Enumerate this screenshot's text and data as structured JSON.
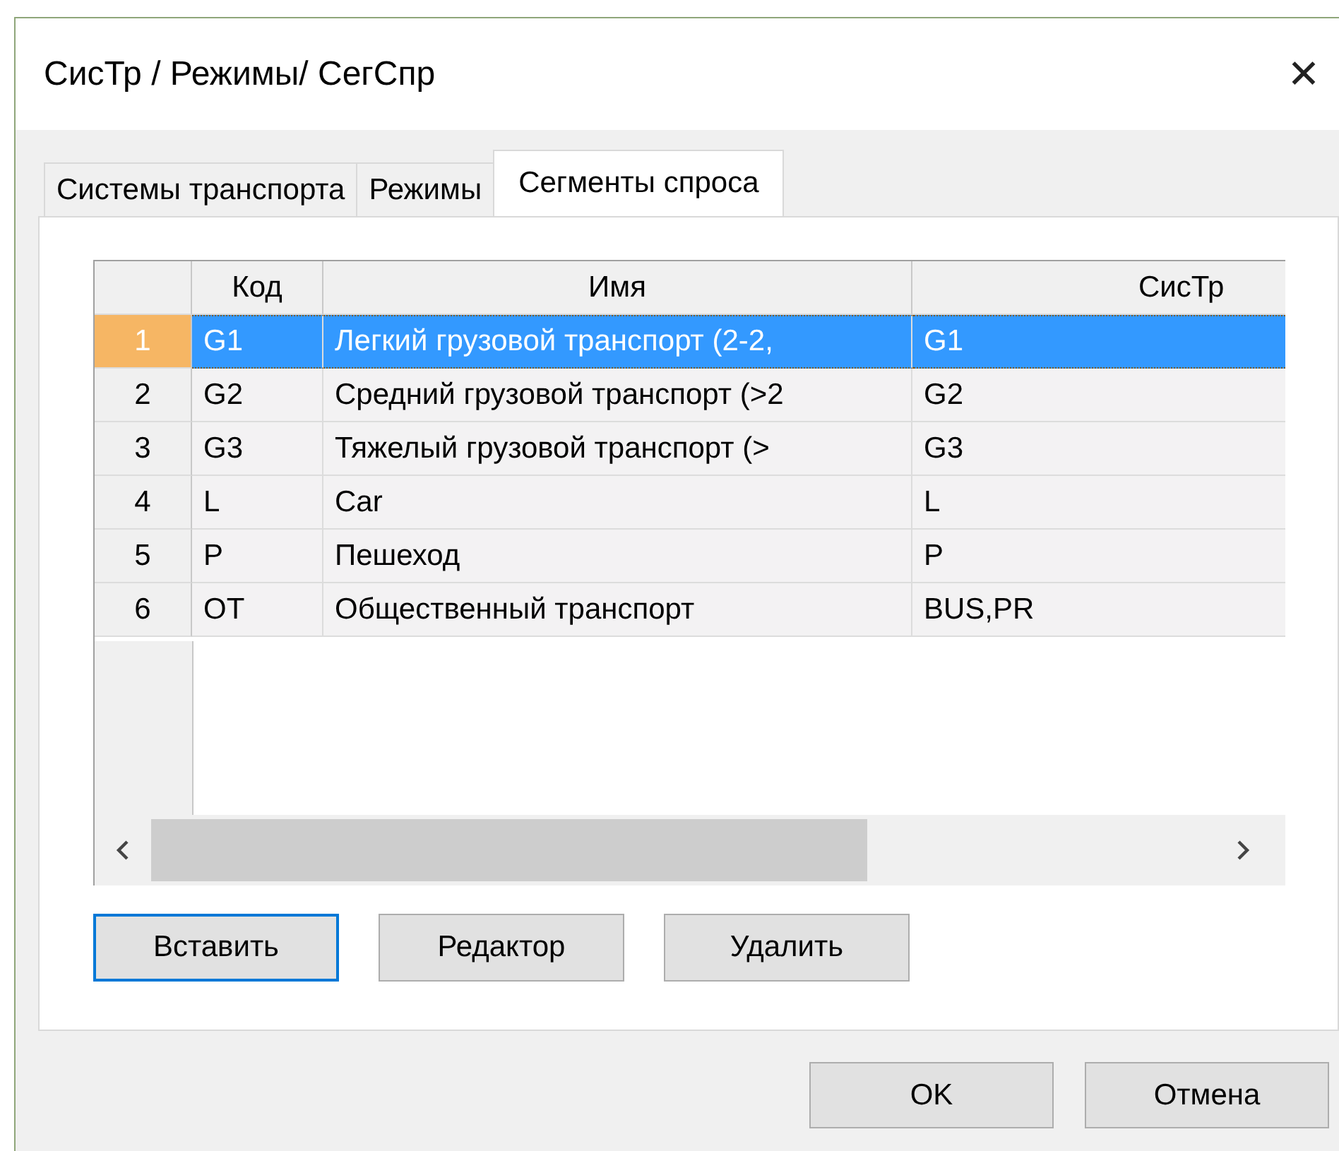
{
  "window": {
    "title": "СисТр / Режимы/ СегСпр",
    "close": "✕"
  },
  "tabs": [
    {
      "label": "Системы транспорта",
      "selected": false
    },
    {
      "label": "Режимы",
      "selected": false
    },
    {
      "label": "Сегменты спроса",
      "selected": true
    }
  ],
  "table": {
    "columns": [
      "Код",
      "Имя",
      "СисТр"
    ],
    "rows": [
      {
        "number": "1",
        "cells": [
          "G1",
          "Легкий грузовой транспорт (2-2,",
          "G1"
        ],
        "selected": true
      },
      {
        "number": "2",
        "cells": [
          "G2",
          "Средний грузовой транспорт (>2",
          "G2"
        ],
        "selected": false
      },
      {
        "number": "3",
        "cells": [
          "G3",
          "Тяжелый грузовой транспорт (>",
          "G3"
        ],
        "selected": false
      },
      {
        "number": "4",
        "cells": [
          "L",
          "Car",
          "L"
        ],
        "selected": false
      },
      {
        "number": "5",
        "cells": [
          "P",
          "Пешеход",
          "P"
        ],
        "selected": false
      },
      {
        "number": "6",
        "cells": [
          "OT",
          "Общественный транспорт",
          "BUS,PR"
        ],
        "selected": false
      }
    ]
  },
  "panel_buttons": [
    {
      "label": "Вставить",
      "focused": true
    },
    {
      "label": "Редактор",
      "focused": false
    },
    {
      "label": "Удалить",
      "focused": false
    }
  ],
  "dialog_buttons": [
    "OK",
    "Отмена"
  ]
}
